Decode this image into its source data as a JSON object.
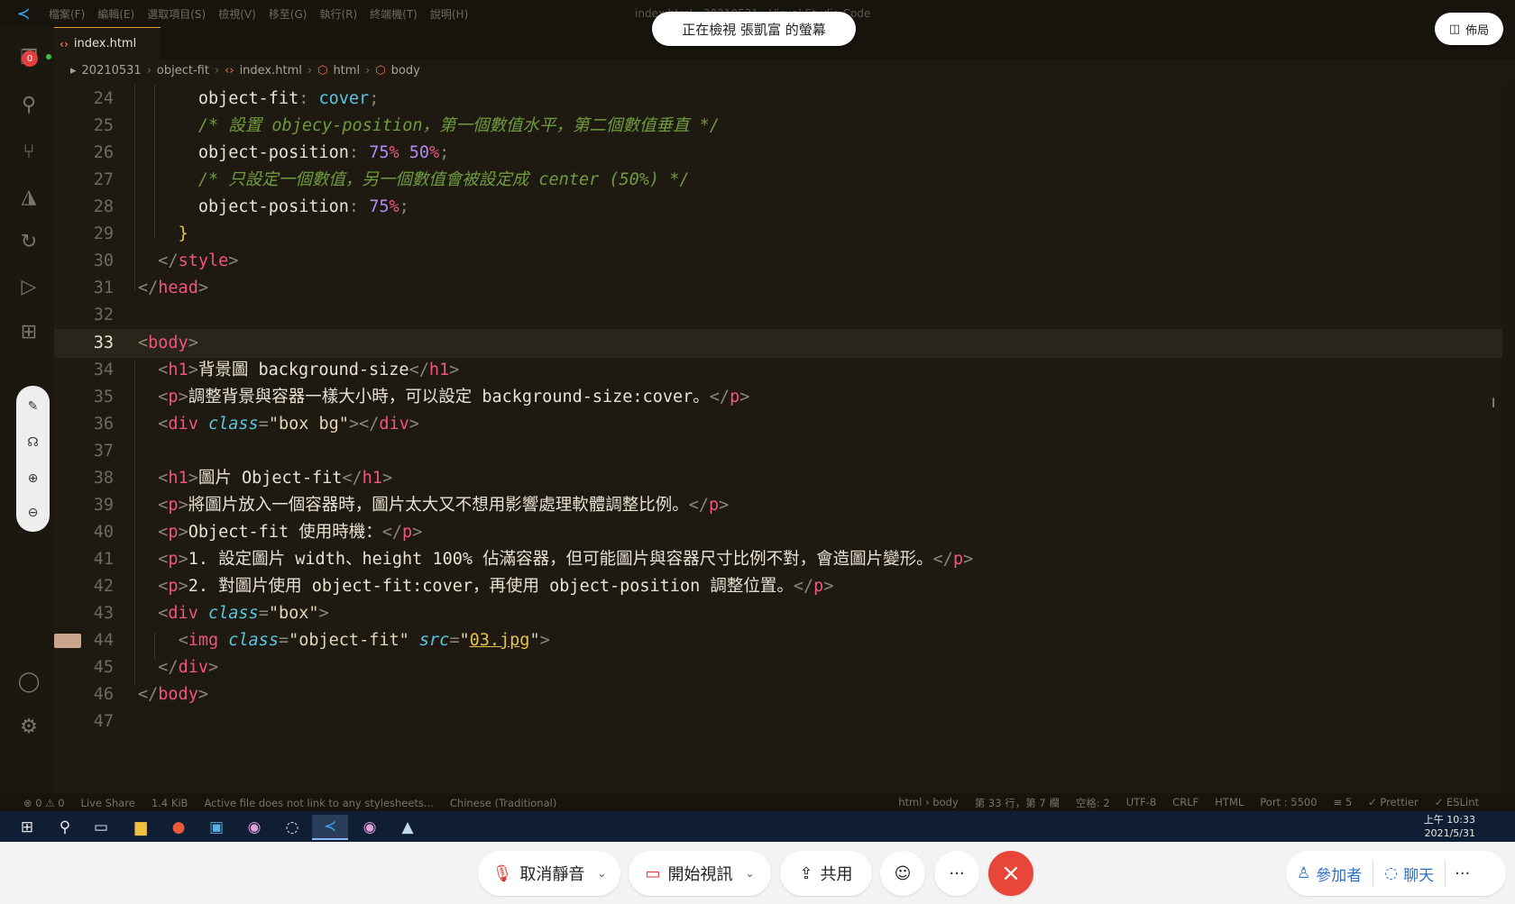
{
  "titlebar": {
    "menu": [
      "檔案(F)",
      "編輯(E)",
      "選取項目(S)",
      "檢視(V)",
      "移至(G)",
      "執行(R)",
      "終端機(T)",
      "說明(H)"
    ],
    "window_title": "index.html - 20210531 - Visual Studio Code"
  },
  "share_banner": {
    "text": "正在檢視 張凱富 的螢幕",
    "layout_label": "佈局"
  },
  "recording_badge": "0",
  "tab": {
    "label": "index.html"
  },
  "breadcrumb": [
    "20210531",
    "object-fit",
    "index.html",
    "html",
    "body"
  ],
  "editor": {
    "current_line": 33
  },
  "statusbar": {
    "left": [
      "⊗ 0 ⚠ 0",
      "Live Share",
      "1.4 KiB",
      "Active file does not link to any stylesheets...",
      "Chinese (Traditional)"
    ],
    "right": [
      "html › body",
      "第 33 行，第 7 欄",
      "空格: 2",
      "UTF-8",
      "CRLF",
      "HTML",
      "Port : 5500",
      "≡ 5",
      "✓ Prettier",
      "✓ ESLint"
    ]
  },
  "taskbar": {
    "time": "上午 10:33",
    "date": "2021/5/31"
  },
  "meeting": {
    "unmute": "取消靜音",
    "video": "開始視訊",
    "share": "共用",
    "participants": "參加者",
    "chat": "聊天"
  },
  "colors": {
    "accent": "#3ea6f5",
    "end_call": "#e8463a",
    "tag": "#f2547c",
    "comment": "#6f9a3e"
  }
}
